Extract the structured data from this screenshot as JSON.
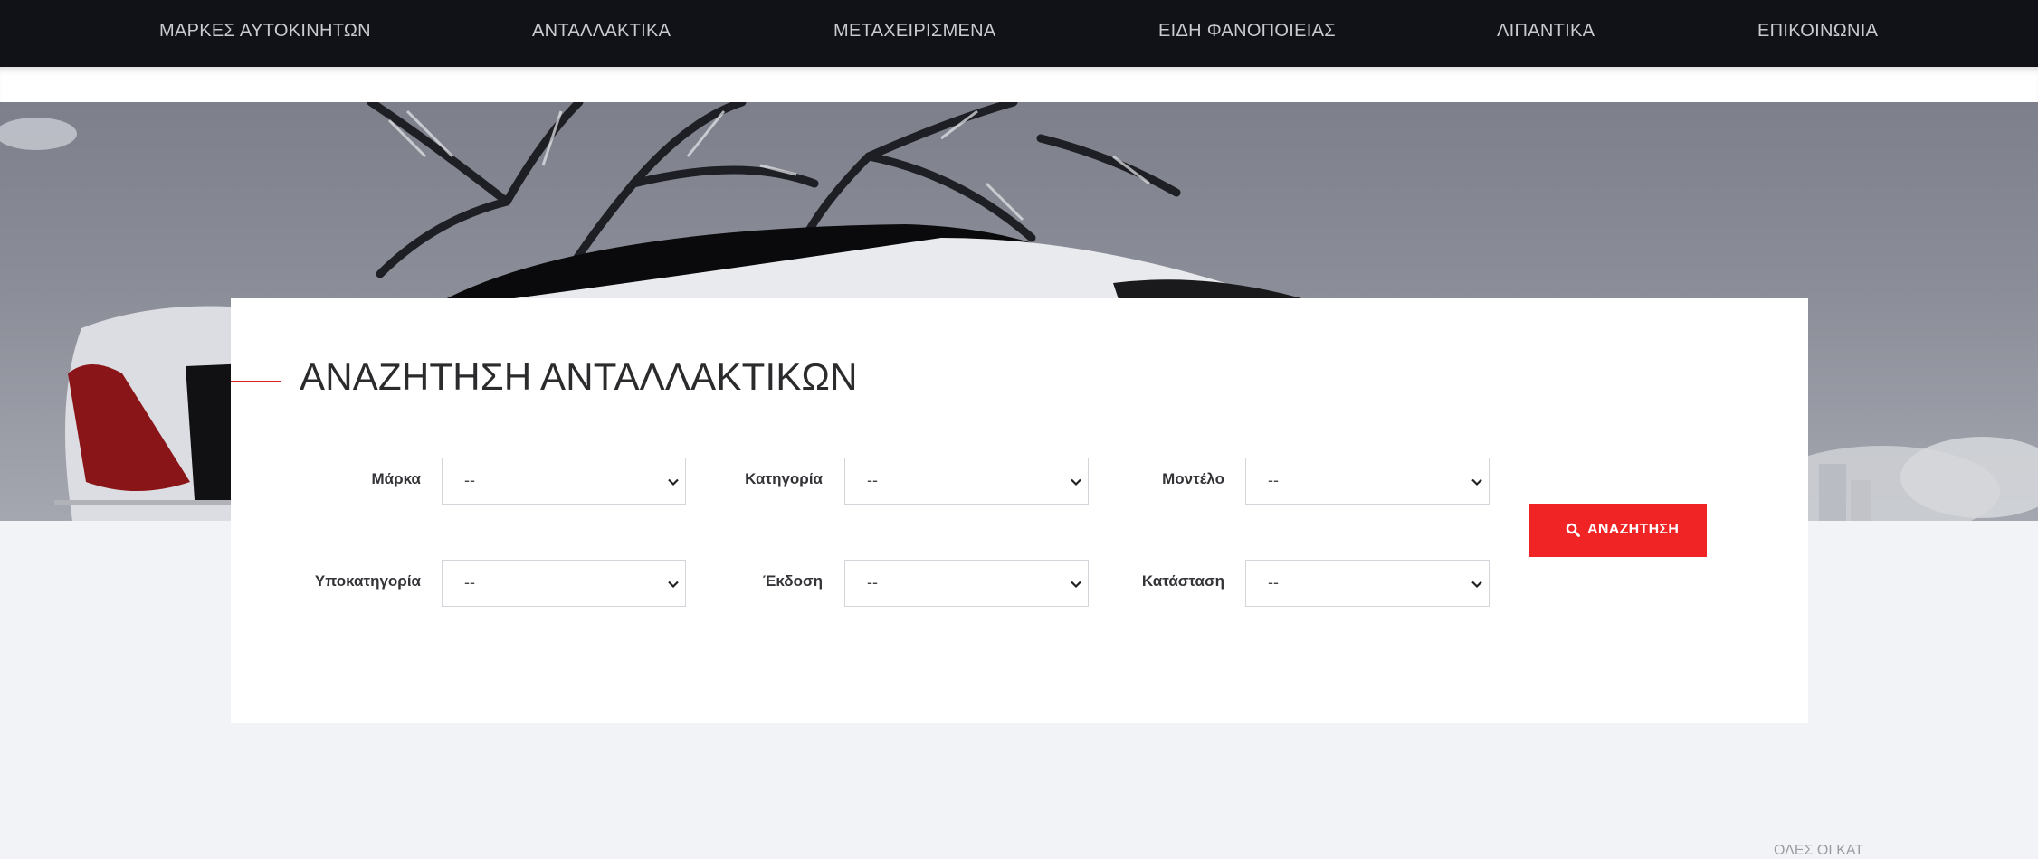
{
  "nav": {
    "items": [
      {
        "label": "ΜΑΡΚΕΣ ΑΥΤΟΚΙΝΗΤΩΝ"
      },
      {
        "label": "ΑΝΤΑΛΛΑΚΤΙΚΑ"
      },
      {
        "label": "ΜΕΤΑΧΕΙΡΙΣΜΕΝΑ"
      },
      {
        "label": "ΕΙΔΗ ΦΑΝΟΠΟΙΕΙΑΣ"
      },
      {
        "label": "ΛΙΠΑΝΤΙΚΑ"
      },
      {
        "label": "ΕΠΙΚΟΙΝΩΝΙΑ"
      }
    ]
  },
  "search": {
    "title": "ΑΝΑΖΗΤΗΣΗ ΑΝΤΑΛΛΑΚΤΙΚΩΝ",
    "fields": [
      {
        "label": "Μάρκα",
        "value": "--"
      },
      {
        "label": "Κατηγορία",
        "value": "--"
      },
      {
        "label": "Μοντέλο",
        "value": "--"
      },
      {
        "label": "Υποκατηγορία",
        "value": "--"
      },
      {
        "label": "Έκδοση",
        "value": "--"
      },
      {
        "label": "Κατάσταση",
        "value": "--"
      }
    ],
    "button_label": "ΑΝΑΖΗΤΗΣΗ"
  },
  "footer": {
    "partial_text": "ΟΛΕΣ ΟΙ ΚΑΤ"
  },
  "colors": {
    "nav_bg": "#111217",
    "accent_red": "#f02424",
    "page_bg": "#f2f3f7"
  },
  "icons": {
    "button": "search-icon",
    "select": "chevron-down-icon"
  }
}
